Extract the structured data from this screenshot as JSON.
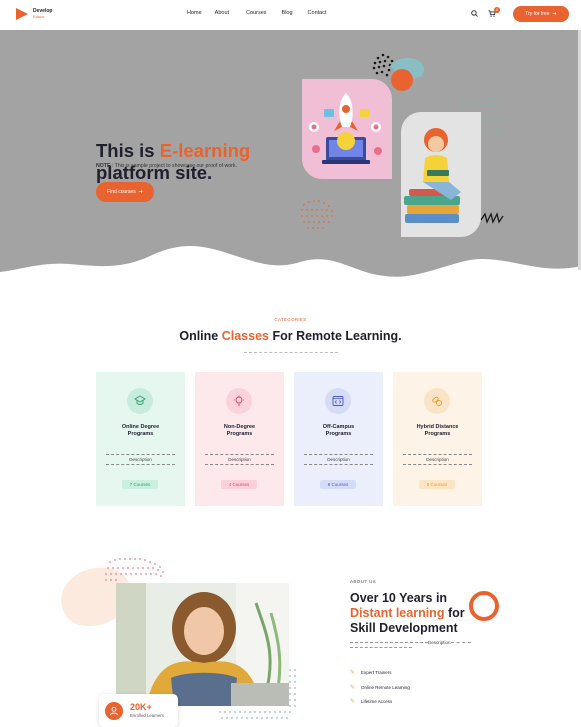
{
  "header": {
    "logo_line1": "Develop",
    "logo_line2": "Educo",
    "nav": [
      "Home",
      "About",
      "Courses",
      "Blog",
      "Contact"
    ],
    "cart_count": "0",
    "cta_label": "Try for free"
  },
  "hero": {
    "title_part1": "This is ",
    "title_accent": "E-learning",
    "title_part2": "platform site.",
    "note_label": "NOTE",
    "note_text": " : This is sample project to showcase our proof of work.",
    "button_label": "Find courses"
  },
  "categories": {
    "eyebrow": "CATEGORIES",
    "title_part1": "Online ",
    "title_accent": "Classes",
    "title_part2": " For Remote Learning.",
    "items": [
      {
        "title_line1": "Online Degree",
        "title_line2": "Programs",
        "desc": "Description",
        "count": "7 Courses",
        "bg": "#e6f7f0",
        "icon_bg": "#c8ecdd",
        "badge_bg": "#c9f0de",
        "badge_color": "#2e9e6a",
        "icon": "graduation-icon"
      },
      {
        "title_line1": "Non-Degree",
        "title_line2": "Programs",
        "desc": "Description",
        "count": "4 Courses",
        "bg": "#fde8ec",
        "icon_bg": "#fbd2da",
        "badge_bg": "#fbd0d9",
        "badge_color": "#d24a64",
        "icon": "lightbulb-icon"
      },
      {
        "title_line1": "Off-Campus",
        "title_line2": "Programs",
        "desc": "Description",
        "count": "8 Courses",
        "bg": "#ebeefb",
        "icon_bg": "#d6dcf7",
        "badge_bg": "#d5dcf8",
        "badge_color": "#4a5cc4",
        "icon": "code-window-icon"
      },
      {
        "title_line1": "Hybrid Distance",
        "title_line2": "Programs",
        "desc": "Description",
        "count": "8 Courses",
        "bg": "#fdf4e7",
        "icon_bg": "#f9e4c7",
        "badge_bg": "#fbe5c4",
        "badge_color": "#e89a2c",
        "icon": "pills-icon"
      }
    ]
  },
  "about": {
    "eyebrow": "ABOUT US",
    "title_line1": "Over 10 Years in",
    "title_accent": "Distant learning",
    "title_line2_rest": " for",
    "title_line3": "Skill Development",
    "desc": "Description",
    "features": [
      "Expert Trainers",
      "Online Remote Learning",
      "Lifetime Access"
    ],
    "stat_number": "20K+",
    "stat_label": "Enrolled Learners"
  },
  "colors": {
    "accent": "#e8632f",
    "hero_bg": "#a3a3a3",
    "dark_text": "#1f1f2e"
  }
}
